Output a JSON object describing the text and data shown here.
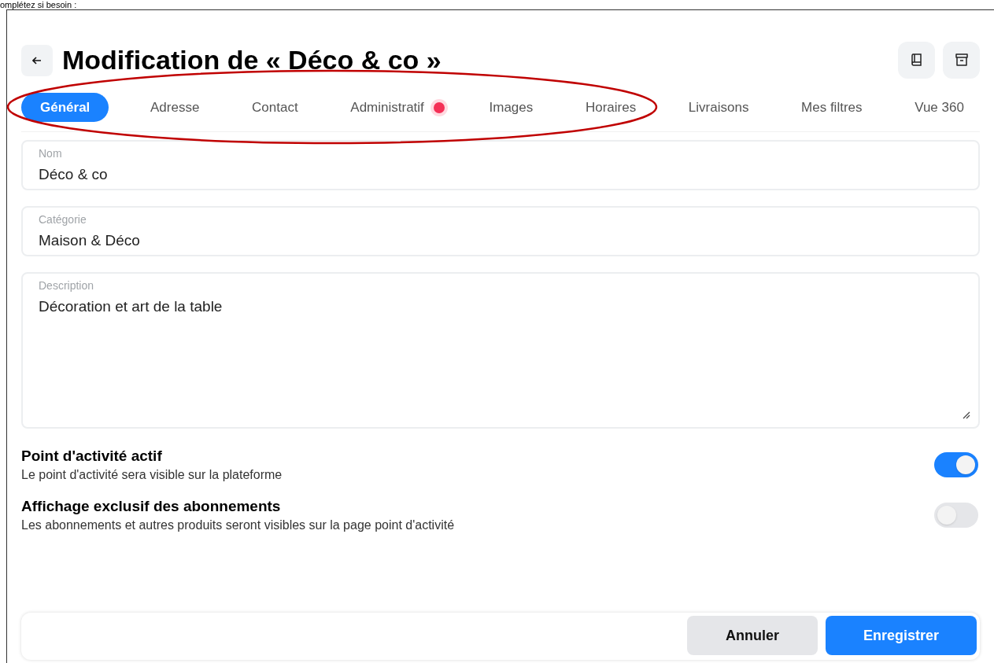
{
  "top_caption": "omplétez si besoin :",
  "header": {
    "title": "Modification de « Déco & co »"
  },
  "tabs": [
    {
      "label": "Général",
      "selected": true,
      "alert": false
    },
    {
      "label": "Adresse",
      "selected": false,
      "alert": false
    },
    {
      "label": "Contact",
      "selected": false,
      "alert": false
    },
    {
      "label": "Administratif",
      "selected": false,
      "alert": true
    },
    {
      "label": "Images",
      "selected": false,
      "alert": false
    },
    {
      "label": "Horaires",
      "selected": false,
      "alert": false
    },
    {
      "label": "Livraisons",
      "selected": false,
      "alert": false
    },
    {
      "label": "Mes filtres",
      "selected": false,
      "alert": false
    },
    {
      "label": "Vue 360",
      "selected": false,
      "alert": false
    }
  ],
  "fields": [
    {
      "kind": "input",
      "label": "Nom",
      "value": "Déco & co"
    },
    {
      "kind": "input",
      "label": "Catégorie",
      "value": "Maison & Déco"
    },
    {
      "kind": "textarea",
      "label": "Description",
      "value": "Décoration et art de la table"
    }
  ],
  "settings": [
    {
      "title": "Point d'activité actif",
      "description": "Le point d'activité sera visible sur la plateforme",
      "on": true
    },
    {
      "title": "Affichage exclusif des abonnements",
      "description": "Les abonnements et autres produits seront visibles sur la page point d'activité",
      "on": false
    }
  ],
  "footer": {
    "buttons": [
      {
        "kind": "secondary",
        "label": "Annuler"
      },
      {
        "kind": "primary",
        "label": "Enregistrer"
      }
    ]
  }
}
